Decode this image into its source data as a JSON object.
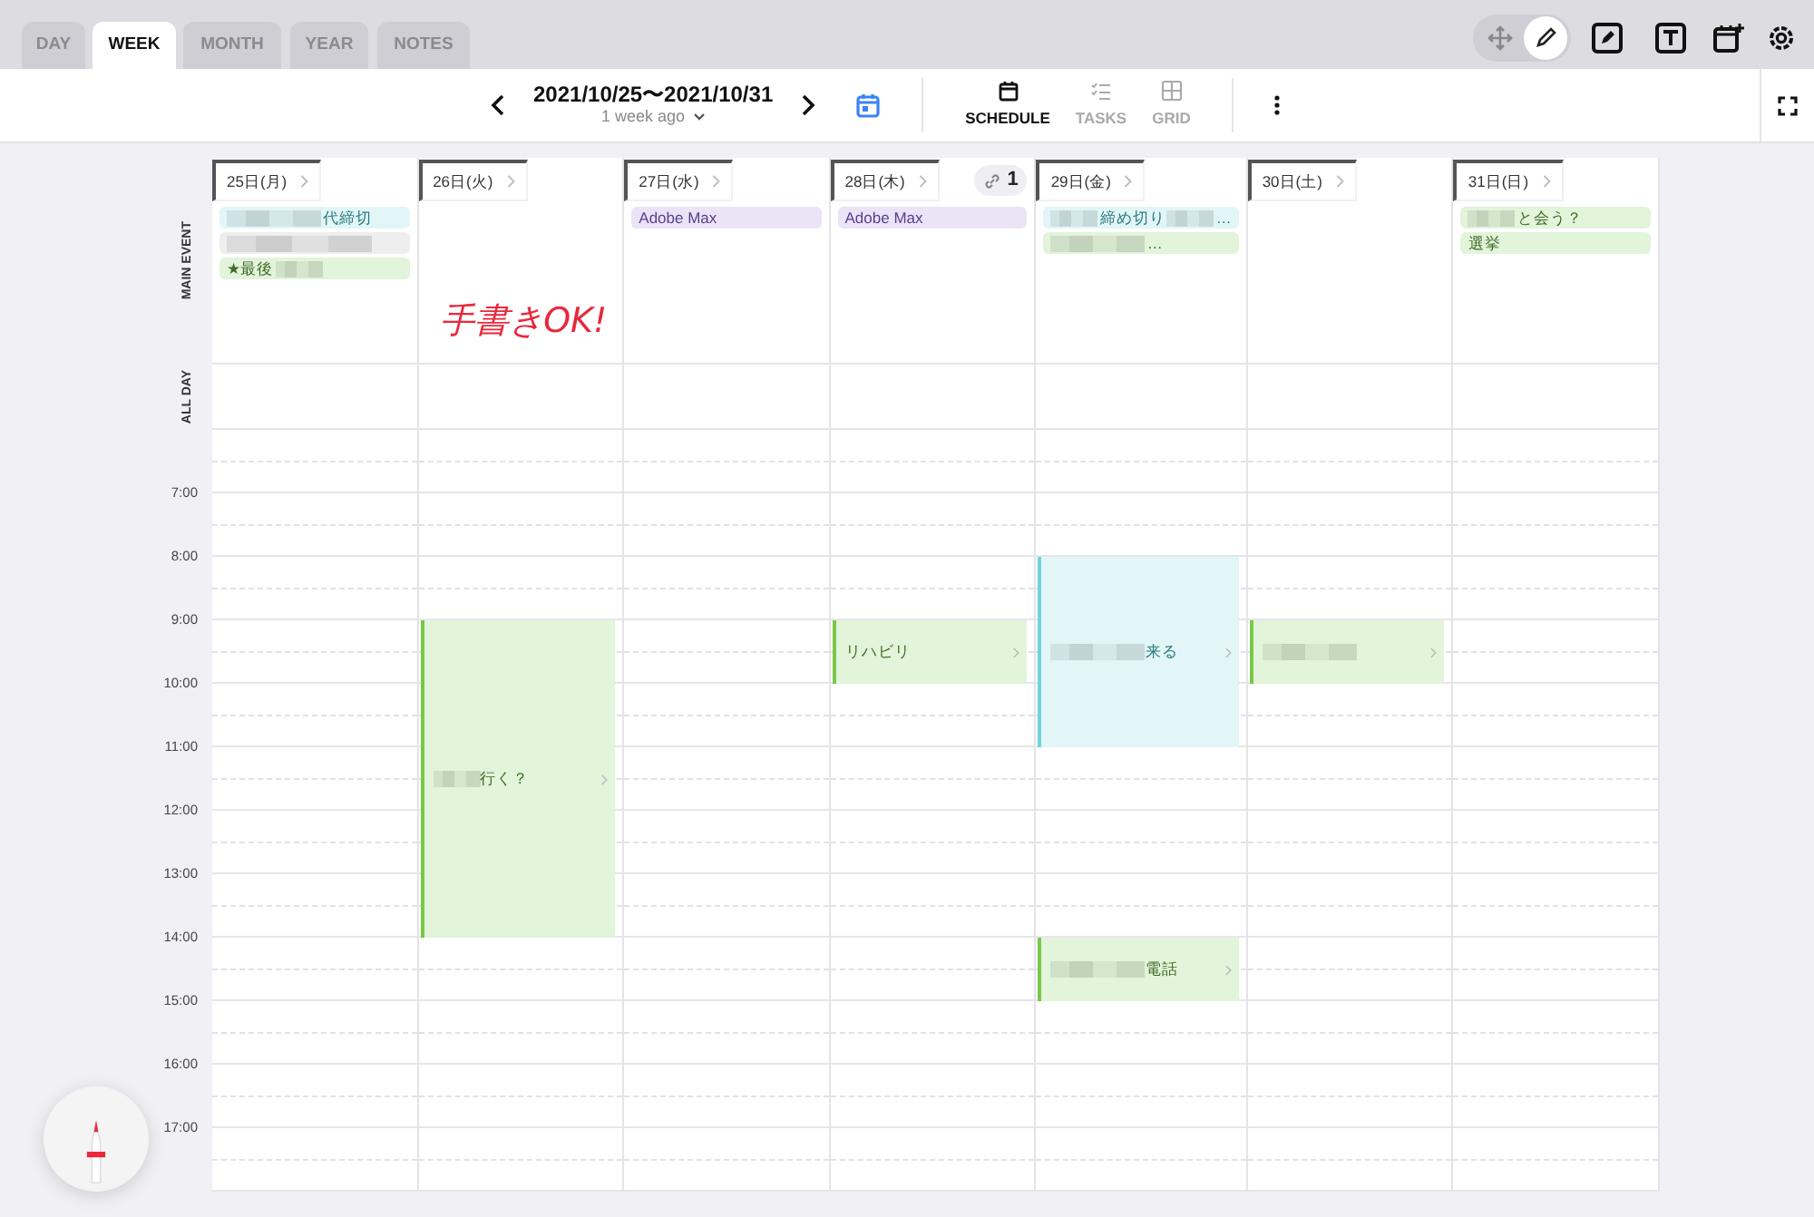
{
  "tabs": [
    {
      "label": "DAY",
      "selected": false
    },
    {
      "label": "WEEK",
      "selected": true
    },
    {
      "label": "MONTH",
      "selected": false
    },
    {
      "label": "YEAR",
      "selected": false
    },
    {
      "label": "NOTES",
      "selected": false
    }
  ],
  "input_modes": [
    {
      "kind": "move",
      "selected": false
    },
    {
      "kind": "pen",
      "selected": true
    }
  ],
  "toolbar": {
    "range": "2021/10/25〜2021/10/31",
    "subtitle": "1 week ago",
    "views": [
      {
        "kind": "schedule",
        "label": "SCHEDULE",
        "selected": true
      },
      {
        "kind": "tasks",
        "label": "TASKS",
        "selected": false
      },
      {
        "kind": "grid",
        "label": "GRID",
        "selected": false
      }
    ]
  },
  "section_labels": {
    "main": "MAIN EVENT",
    "all_day": "ALL DAY"
  },
  "time_labels": [
    "7:00",
    "8:00",
    "9:00",
    "10:00",
    "11:00",
    "12:00",
    "13:00",
    "14:00",
    "15:00",
    "16:00",
    "17:00"
  ],
  "days": [
    {
      "label": "25日(月)",
      "main_events": [
        {
          "color": "#e2f6f7",
          "parts": [
            {
              "kind": "blur-long"
            },
            {
              "kind": "text",
              "text": "代締切"
            }
          ]
        },
        {
          "color": "#eeeeee",
          "parts": [
            {
              "kind": "blur-full"
            }
          ]
        },
        {
          "color": "#e2f4da",
          "parts": [
            {
              "kind": "text",
              "text": "★最後"
            },
            {
              "kind": "blur"
            }
          ]
        }
      ]
    },
    {
      "label": "26日(火)",
      "handwriting": "手書きOK!",
      "slots": [
        {
          "busy": false
        },
        {
          "busy": false
        },
        {
          "busy": false
        },
        {
          "busy": true,
          "event": {
            "color": "#e2f4da",
            "parts": [
              {
                "kind": "blur"
              },
              {
                "kind": "text",
                "text": "行く？"
              }
            ]
          }
        },
        {
          "busy": true
        },
        {
          "busy": true
        },
        {
          "busy": true
        },
        {
          "busy": true
        }
      ]
    },
    {
      "label": "27日(水)",
      "main_events": [
        {
          "color": "#ebe4f7",
          "parts": [
            {
              "kind": "text",
              "text": "Adobe Max"
            }
          ]
        }
      ]
    },
    {
      "label": "28日(木)",
      "link_count": "1",
      "main_events": [
        {
          "color": "#ebe4f7",
          "parts": [
            {
              "kind": "text",
              "text": "Adobe Max"
            }
          ]
        }
      ],
      "slots": [
        {
          "busy": false
        },
        {
          "busy": false
        },
        {
          "busy": false
        },
        {
          "busy": true,
          "event": {
            "color": "#e2f4da",
            "parts": [
              {
                "kind": "text",
                "text": "リハビリ"
              }
            ]
          }
        }
      ]
    },
    {
      "label": "29日(金)",
      "main_events": [
        {
          "color": "#e2f6f7",
          "parts": [
            {
              "kind": "blur"
            },
            {
              "kind": "text",
              "text": "締め切り"
            },
            {
              "kind": "blur"
            },
            {
              "kind": "text",
              "text": "…"
            }
          ]
        },
        {
          "color": "#e2f4da",
          "parts": [
            {
              "kind": "blur-long"
            },
            {
              "kind": "text",
              "text": "…"
            }
          ]
        }
      ],
      "slots": [
        {
          "busy": false
        },
        {
          "busy": false
        },
        {
          "busy": true,
          "event": {
            "color": "#e2f6f7",
            "parts": [
              {
                "kind": "blur-long"
              },
              {
                "kind": "text",
                "text": "来る"
              }
            ]
          }
        },
        {
          "busy": true
        },
        {
          "busy": true
        },
        {
          "busy": false
        },
        {
          "busy": false
        },
        {
          "busy": false
        },
        {
          "busy": true,
          "event": {
            "color": "#e2f4da",
            "parts": [
              {
                "kind": "blur-long"
              },
              {
                "kind": "text",
                "text": "電話"
              }
            ]
          }
        }
      ]
    },
    {
      "label": "30日(土)",
      "slots": [
        {
          "busy": false
        },
        {
          "busy": false
        },
        {
          "busy": false
        },
        {
          "busy": true,
          "event": {
            "color": "#e2f4da",
            "parts": [
              {
                "kind": "blur-long"
              }
            ]
          }
        }
      ]
    },
    {
      "label": "31日(日)",
      "main_events": [
        {
          "color": "#e2f4da",
          "parts": [
            {
              "kind": "blur"
            },
            {
              "kind": "text",
              "text": "と会う？"
            }
          ]
        },
        {
          "color": "#e2f4da",
          "parts": [
            {
              "kind": "text",
              "text": "選挙"
            }
          ]
        }
      ]
    }
  ]
}
